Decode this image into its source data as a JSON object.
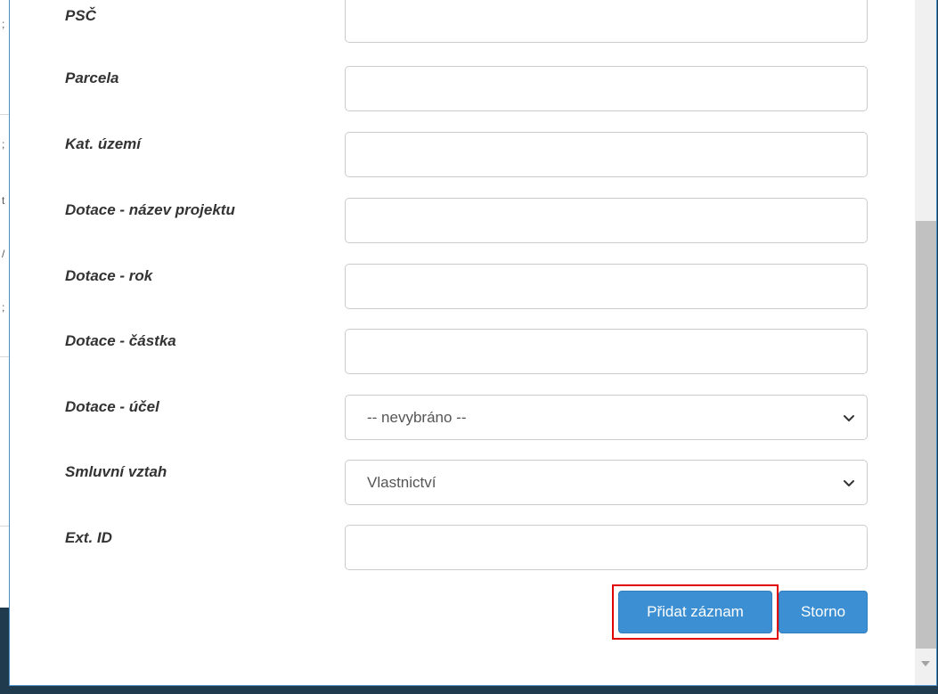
{
  "form": {
    "fields": [
      {
        "label": "PSČ"
      },
      {
        "label": "Parcela"
      },
      {
        "label": "Kat. území"
      },
      {
        "label": "Dotace - název projektu"
      },
      {
        "label": "Dotace - rok"
      },
      {
        "label": "Dotace - částka"
      },
      {
        "label": "Dotace - účel",
        "value": "-- nevybráno --"
      },
      {
        "label": "Smluvní vztah",
        "value": "Vlastnictví"
      },
      {
        "label": "Ext. ID"
      }
    ]
  },
  "buttons": {
    "add_label": "Přidat záznam",
    "cancel_label": "Storno"
  },
  "colors": {
    "primary": "#3c8fd2",
    "highlight": "#e00000",
    "backdrop": "#1f3b4d"
  }
}
